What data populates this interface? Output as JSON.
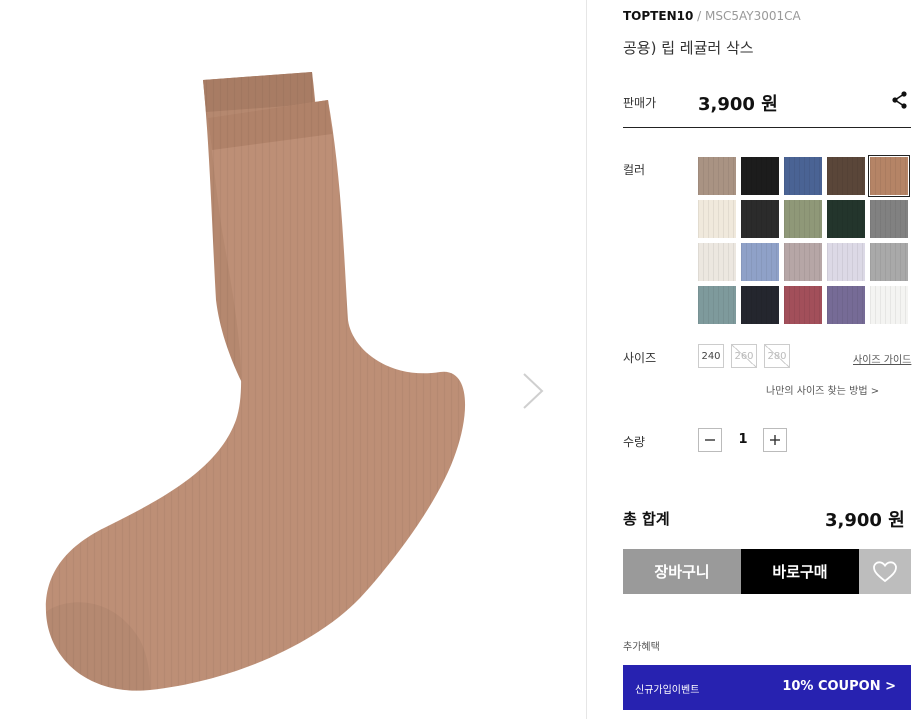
{
  "product": {
    "brand": "TOPTEN10",
    "brand_separator": "/",
    "code": "MSC5AY3001CA",
    "name": "공용) 립 레귤러 삭스"
  },
  "price": {
    "label": "판매가",
    "value": "3,900 원"
  },
  "color": {
    "label": "컬러",
    "swatches": [
      "#a99383",
      "#1c1c1c",
      "#4a6394",
      "#5a4639",
      "#b58466",
      "#f0e9dc",
      "#2b2b2b",
      "#8f9878",
      "#23352c",
      "#818181",
      "#ece7e0",
      "#8fa1c8",
      "#b6a6a6",
      "#dcd9e6",
      "#a9a9a9",
      "#7e9a9c",
      "#24262e",
      "#a24f5a",
      "#766b96",
      "#f4f4f2"
    ],
    "selected_index": 4
  },
  "size": {
    "label": "사이즈",
    "options": [
      {
        "value": "240",
        "available": true
      },
      {
        "value": "260",
        "available": false
      },
      {
        "value": "280",
        "available": false
      }
    ],
    "guide_link": "사이즈 가이드",
    "finder_link": "나만의 사이즈 찾는 방법 >"
  },
  "quantity": {
    "label": "수량",
    "value": "1",
    "minus_icon": "minus-icon",
    "plus_icon": "plus-icon"
  },
  "total": {
    "label": "총 합계",
    "value": "3,900 원"
  },
  "actions": {
    "cart": "장바구니",
    "buy": "바로구매",
    "wish_icon": "heart-icon"
  },
  "benefits": {
    "label": "추가혜택",
    "event": "신규가입이벤트",
    "coupon": "10% COUPON >"
  },
  "colors": {
    "sock": "#b58871",
    "coupon_bg": "#2722b0",
    "cart_bg": "#9a9a9a",
    "buy_bg": "#000000"
  }
}
